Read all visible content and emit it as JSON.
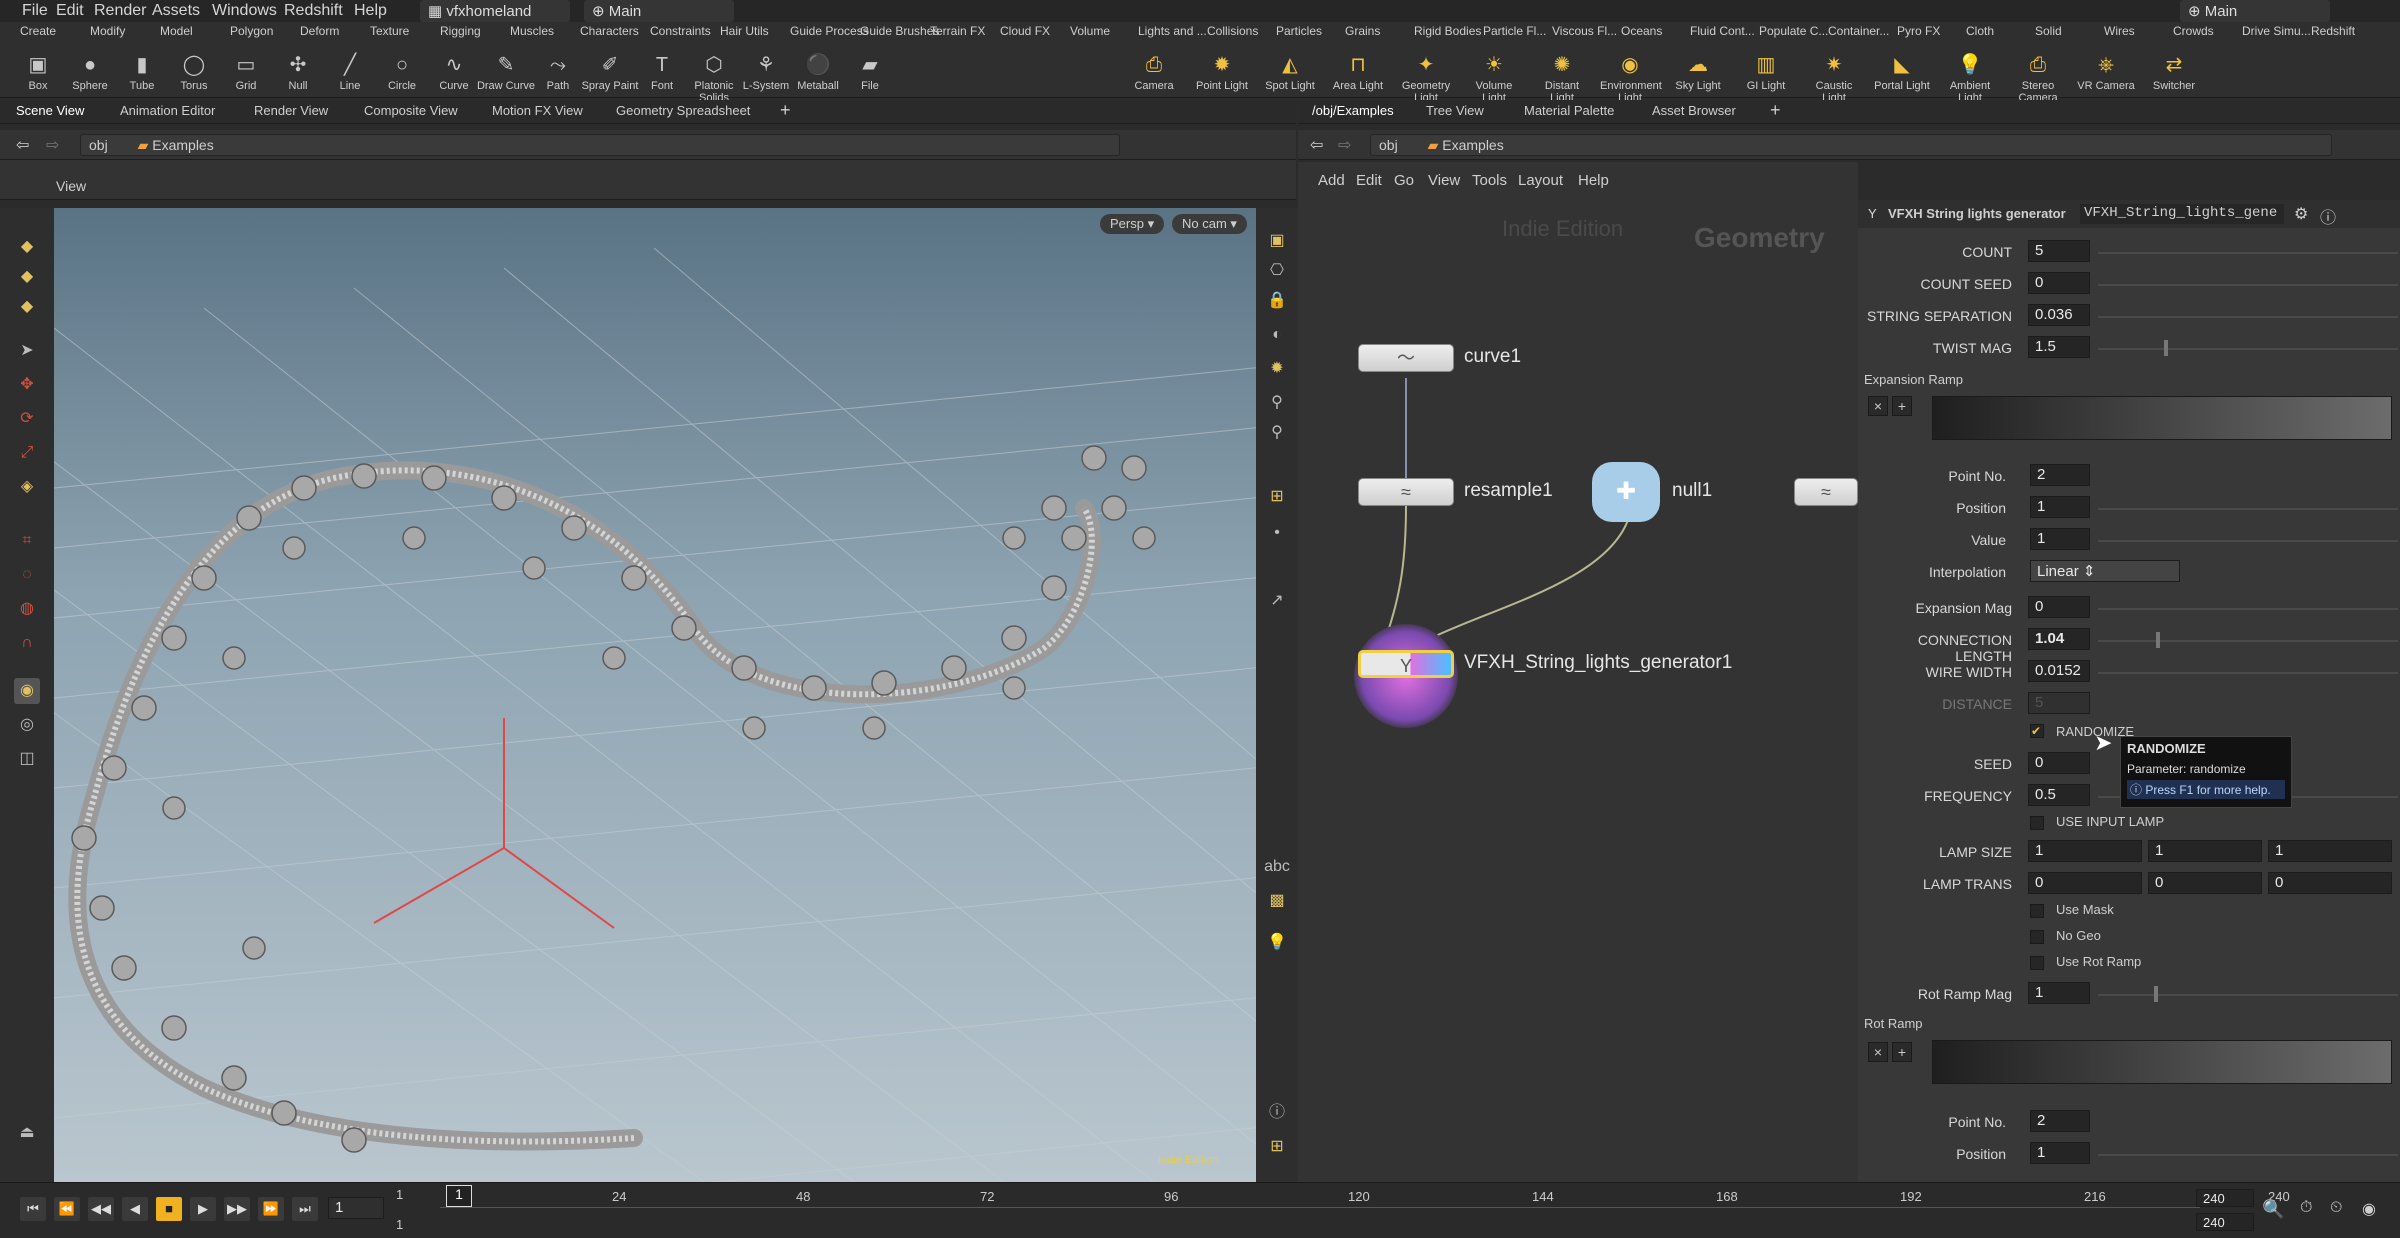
{
  "menu": {
    "items": [
      "File",
      "Edit",
      "Render",
      "Assets",
      "Windows",
      "Redshift",
      "Help"
    ],
    "desktop": "vfxhomeland",
    "context": "Main",
    "right_context": "Main"
  },
  "shelf": {
    "left_tabs": [
      "Create",
      "Modify",
      "Model",
      "Polygon",
      "Deform",
      "Texture",
      "Rigging",
      "Muscles",
      "Characters",
      "Constraints",
      "Hair Utils",
      "Guide Process",
      "Guide Brushes",
      "Terrain FX",
      "Cloud FX",
      "Volume"
    ],
    "right_tabs": [
      "Lights and ...",
      "Collisions",
      "Particles",
      "Grains",
      "Rigid Bodies",
      "Particle Fl...",
      "Viscous Fl...",
      "Oceans",
      "Fluid Cont...",
      "Populate C...",
      "Container...",
      "Pyro FX",
      "Cloth",
      "Solid",
      "Wires",
      "Crowds",
      "Drive Simu...",
      "Redshift"
    ],
    "left_tools": [
      {
        "label": "Box",
        "icon": "box-icon"
      },
      {
        "label": "Sphere",
        "icon": "sphere-icon"
      },
      {
        "label": "Tube",
        "icon": "tube-icon"
      },
      {
        "label": "Torus",
        "icon": "torus-icon"
      },
      {
        "label": "Grid",
        "icon": "grid-icon"
      },
      {
        "label": "Null",
        "icon": "null-icon"
      },
      {
        "label": "Line",
        "icon": "line-icon"
      },
      {
        "label": "Circle",
        "icon": "circle-icon"
      },
      {
        "label": "Curve",
        "icon": "curve-icon"
      },
      {
        "label": "Draw Curve",
        "icon": "draw-curve-icon"
      },
      {
        "label": "Path",
        "icon": "path-icon"
      },
      {
        "label": "Spray Paint",
        "icon": "spray-paint-icon"
      },
      {
        "label": "Font",
        "icon": "font-icon"
      },
      {
        "label": "Platonic Solids",
        "icon": "platonic-icon"
      },
      {
        "label": "L-System",
        "icon": "lsystem-icon"
      },
      {
        "label": "Metaball",
        "icon": "metaball-icon"
      },
      {
        "label": "File",
        "icon": "file-icon"
      }
    ],
    "right_tools": [
      {
        "label": "Camera",
        "icon": "camera-icon"
      },
      {
        "label": "Point Light",
        "icon": "point-light-icon"
      },
      {
        "label": "Spot Light",
        "icon": "spot-light-icon"
      },
      {
        "label": "Area Light",
        "icon": "area-light-icon"
      },
      {
        "label": "Geometry Light",
        "icon": "geometry-light-icon"
      },
      {
        "label": "Volume Light",
        "icon": "volume-light-icon"
      },
      {
        "label": "Distant Light",
        "icon": "distant-light-icon"
      },
      {
        "label": "Environment Light",
        "icon": "environment-light-icon"
      },
      {
        "label": "Sky Light",
        "icon": "sky-light-icon"
      },
      {
        "label": "GI Light",
        "icon": "gi-light-icon"
      },
      {
        "label": "Caustic Light",
        "icon": "caustic-light-icon"
      },
      {
        "label": "Portal Light",
        "icon": "portal-light-icon"
      },
      {
        "label": "Ambient Light",
        "icon": "ambient-light-icon"
      },
      {
        "label": "Stereo Camera",
        "icon": "stereo-camera-icon"
      },
      {
        "label": "VR Camera",
        "icon": "vr-camera-icon"
      },
      {
        "label": "Switcher",
        "icon": "switcher-icon"
      }
    ]
  },
  "left_pane": {
    "tabs": [
      "Scene View",
      "Animation Editor",
      "Render View",
      "Composite View",
      "Motion FX View",
      "Geometry Spreadsheet"
    ],
    "path_obj": "obj",
    "path_node": "Examples",
    "view_label": "View",
    "persp": "Persp",
    "cam": "No cam",
    "watermark": "Indie Edition"
  },
  "right_pane": {
    "tabs": [
      "/obj/Examples",
      "Tree View",
      "Material Palette",
      "Asset Browser"
    ],
    "path_obj": "obj",
    "path_node": "Examples",
    "menu": [
      "Add",
      "Edit",
      "Go",
      "View",
      "Tools",
      "Layout",
      "Help"
    ],
    "indie": "Indie Edition",
    "context_label": "Geometry",
    "nodes": [
      "curve1",
      "resample1",
      "null1",
      "VFXH_String_lights_generator1"
    ]
  },
  "params": {
    "node_type": "VFXH String lights generator",
    "node_name": "VFXH_String_lights_gene",
    "count_label": "COUNT",
    "count": "5",
    "count_seed_label": "COUNT SEED",
    "count_seed": "0",
    "string_sep_label": "STRING SEPARATION",
    "string_sep": "0.036",
    "twist_label": "TWIST MAG",
    "twist": "1.5",
    "exp_ramp_label": "Expansion Ramp",
    "point_no_label": "Point No.",
    "point_no": "2",
    "position_label": "Position",
    "position": "1",
    "value_label": "Value",
    "value": "1",
    "interp_label": "Interpolation",
    "interp": "Linear",
    "exp_mag_label": "Expansion Mag",
    "exp_mag": "0",
    "conn_len_label": "CONNECTION LENGTH",
    "conn_len": "1.04",
    "wire_width_label": "WIRE WIDTH",
    "wire_width": "0.0152",
    "distance_label": "DISTANCE",
    "distance": "5",
    "randomize_label": "RANDOMIZE",
    "seed_label": "SEED",
    "seed": "0",
    "freq_label": "FREQUENCY",
    "freq": "0.5",
    "use_input_lamp": "USE INPUT LAMP",
    "lamp_size_label": "LAMP SIZE",
    "lamp_size": [
      "1",
      "1",
      "1"
    ],
    "lamp_trans_label": "LAMP TRANS",
    "lamp_trans": [
      "0",
      "0",
      "0"
    ],
    "use_mask": "Use Mask",
    "no_geo": "No Geo",
    "use_rot_ramp": "Use Rot Ramp",
    "rot_ramp_mag_label": "Rot Ramp Mag",
    "rot_ramp_mag": "1",
    "rot_ramp_label": "Rot Ramp",
    "rot_point_no": "2",
    "rot_position": "1"
  },
  "tooltip": {
    "title": "RANDOMIZE",
    "param": "Parameter: randomize",
    "help": "Press F1 for more help."
  },
  "timeline": {
    "frame": "1",
    "start": "1",
    "start2": "1",
    "ticks": [
      "1",
      "24",
      "48",
      "72",
      "96",
      "120",
      "144",
      "168",
      "192",
      "216",
      "240"
    ],
    "end": "240",
    "end2": "240"
  }
}
